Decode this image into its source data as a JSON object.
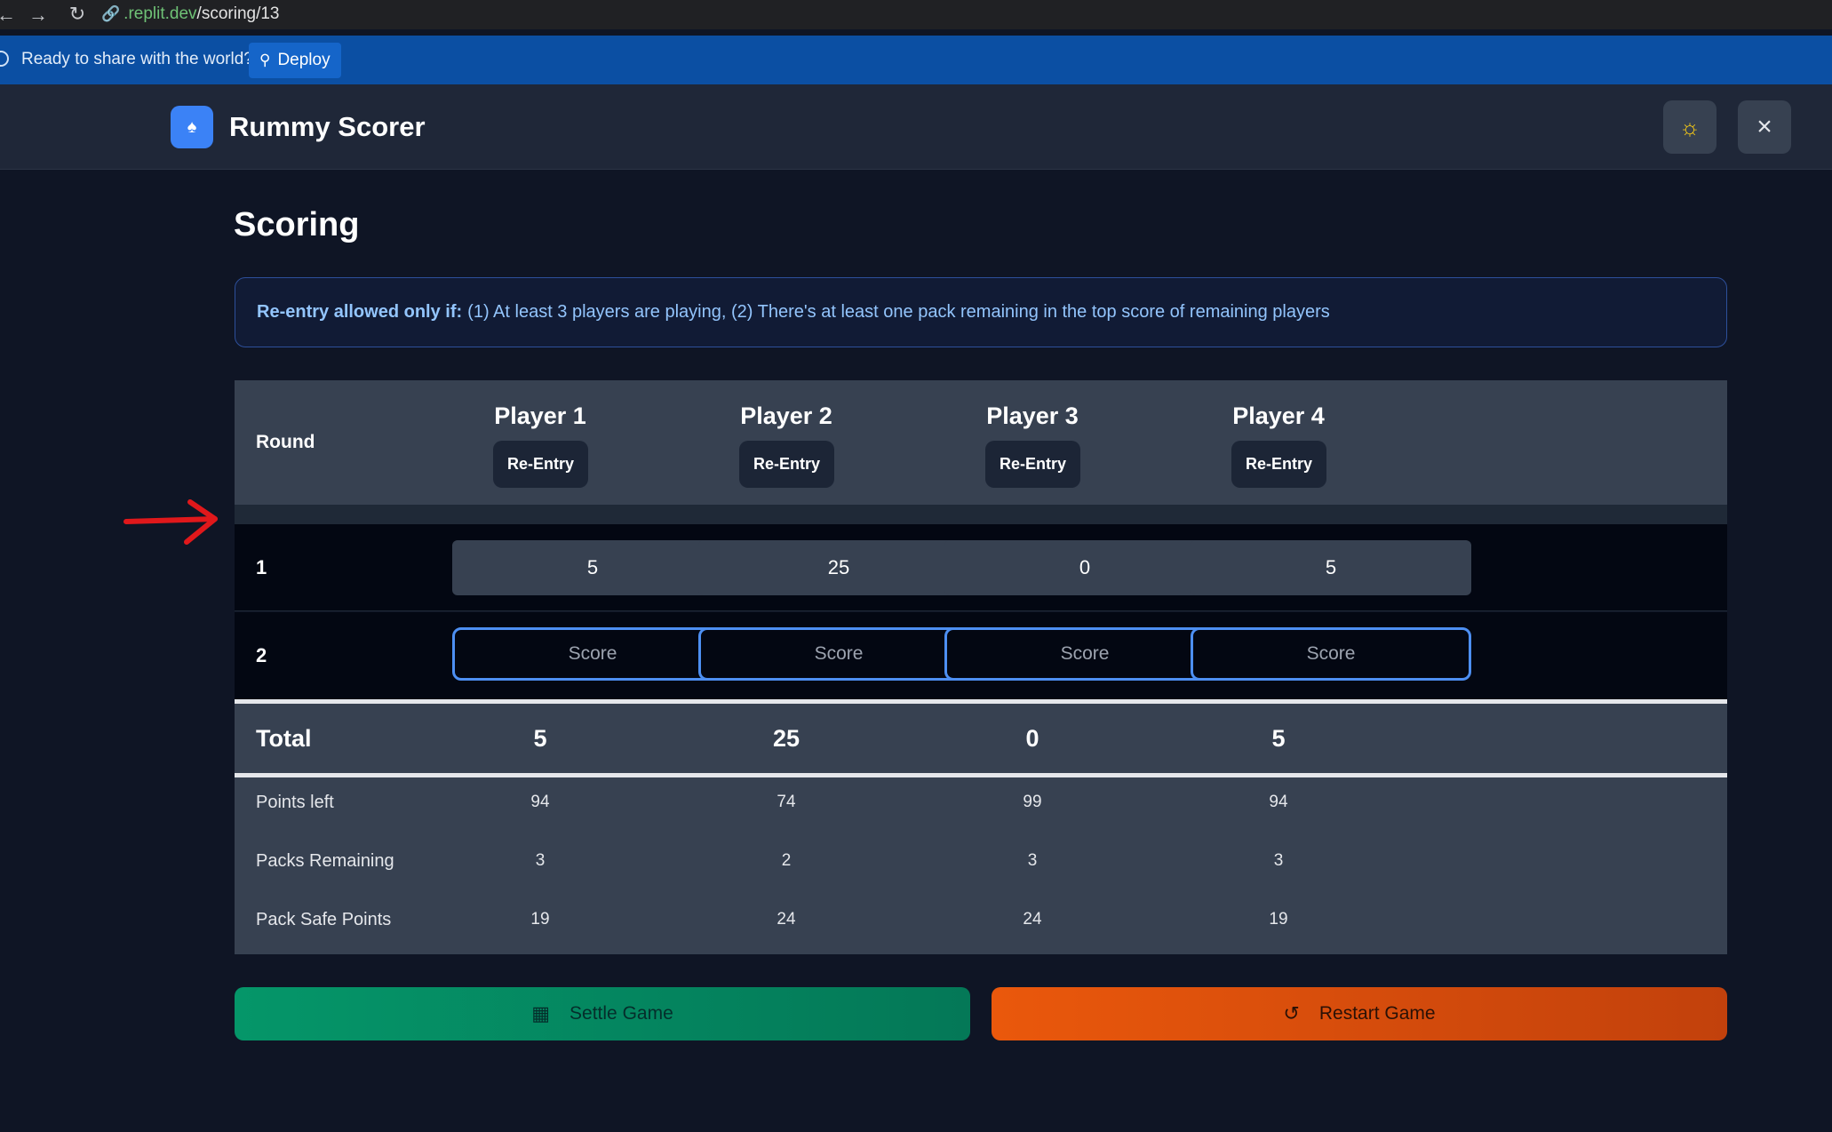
{
  "browser": {
    "url_host": ".replit.dev",
    "url_path": "/scoring/13"
  },
  "banner": {
    "message": "Ready to share with the world?",
    "deploy_label": "Deploy"
  },
  "app": {
    "title": "Rummy Scorer"
  },
  "page": {
    "title": "Scoring",
    "notice_bold": "Re-entry allowed only if:",
    "notice_text": "(1) At least 3 players are playing, (2) There's at least one pack remaining in the top score of remaining players"
  },
  "table": {
    "round_header": "Round",
    "reentry_label": "Re-Entry",
    "players": [
      "Player 1",
      "Player 2",
      "Player 3",
      "Player 4"
    ],
    "rounds": [
      {
        "number": "1",
        "scores": [
          "5",
          "25",
          "0",
          "5"
        ]
      },
      {
        "number": "2",
        "placeholder": "Score"
      }
    ],
    "total_label": "Total",
    "totals": [
      "5",
      "25",
      "0",
      "5"
    ],
    "stats": [
      {
        "label": "Points left",
        "values": [
          "94",
          "74",
          "99",
          "94"
        ]
      },
      {
        "label": "Packs Remaining",
        "values": [
          "3",
          "2",
          "3",
          "3"
        ]
      },
      {
        "label": "Pack Safe Points",
        "values": [
          "19",
          "24",
          "24",
          "19"
        ]
      }
    ]
  },
  "actions": {
    "settle_label": "Settle Game",
    "restart_label": "Restart Game"
  },
  "colors": {
    "accent_blue": "#3b82f6",
    "settle_green": "#059669",
    "restart_orange": "#ea580c",
    "annotation_red": "#e0181b"
  },
  "icons": {
    "logo": "spade-icon",
    "theme": "sun-icon",
    "close": "close-icon",
    "settle": "calculator-icon",
    "restart": "rotate-ccw-icon"
  }
}
